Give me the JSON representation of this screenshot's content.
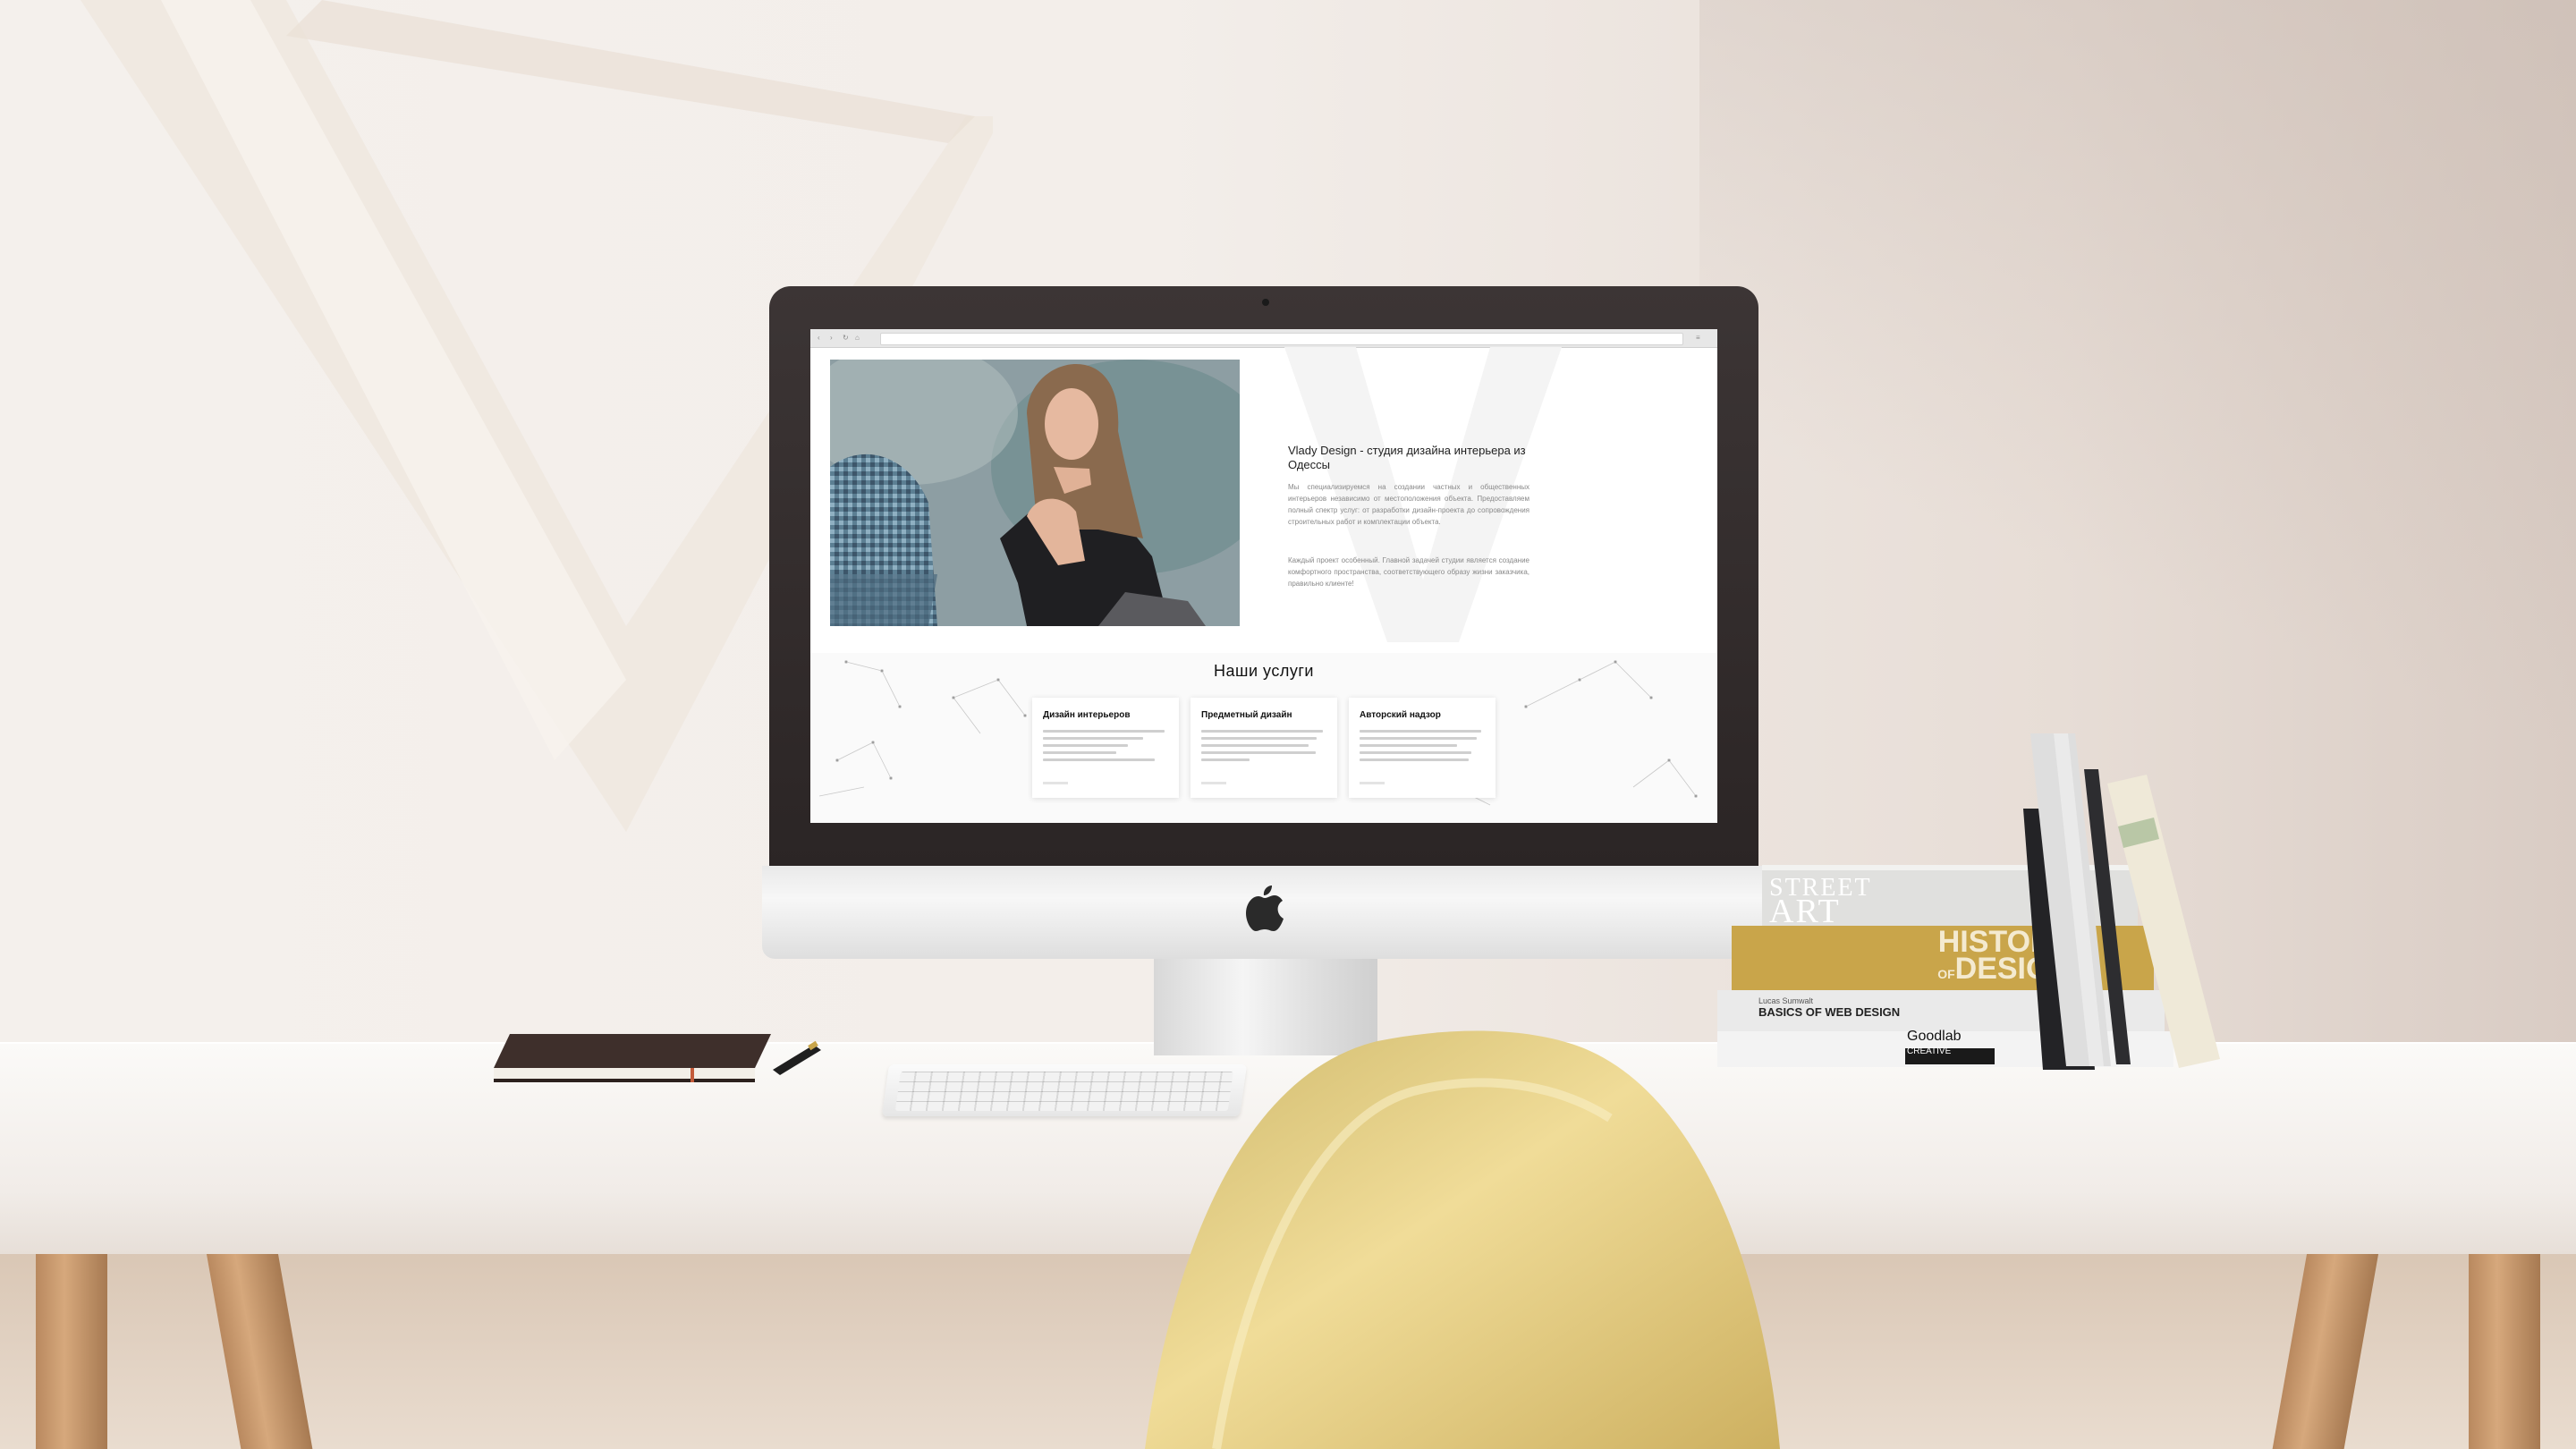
{
  "scene": {
    "description_colors": {
      "wall": "#f3eeea",
      "desk": "#f7f5f2",
      "chair": "#ead28a",
      "accent_book": "#c9a54a"
    }
  },
  "website": {
    "about": {
      "title": "Vlady Design - студия дизайна интерьера из Одессы",
      "paragraph1": "Мы специализируемся на создании частных и общественных интерьеров независимо от местоположения объекта. Предоставляем полный спектр услуг: от разработки дизайн-проекта до сопровождения строительных работ и комплектации объекта.",
      "paragraph2": "Каждый проект особенный. Главной задачей студии является создание комфортного пространства, соответствующего образу жизни заказчика, правильно клиенте!"
    },
    "services": {
      "title": "Наши услуги",
      "cards": [
        {
          "title": "Дизайн интерьеров"
        },
        {
          "title": "Предметный дизайн"
        },
        {
          "title": "Авторский надзор"
        }
      ]
    }
  },
  "books": {
    "street_art": {
      "line1": "STREET",
      "line2": "ART"
    },
    "history_of_design": {
      "line1": "HISTORY",
      "line2": "OF",
      "line3": "DESIGN"
    },
    "basics_web_design": {
      "author": "Lucas Sumwalt",
      "title": "BASICS OF WEB DESIGN"
    },
    "goodlab": {
      "title": "Goodlab",
      "subtitle": "CREATIVE"
    }
  }
}
